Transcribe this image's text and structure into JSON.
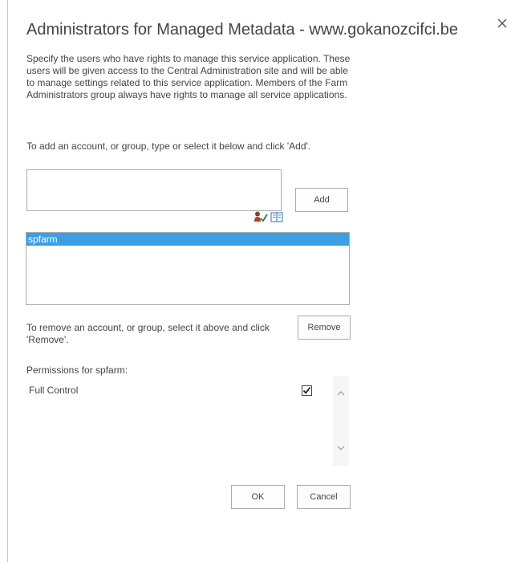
{
  "dialog": {
    "title": "Administrators for Managed Metadata - www.gokanozcifci.be",
    "close_icon": "close-icon"
  },
  "description": "Specify the users who have rights to manage this service application. These users will be given access to the Central Administration site and will be able to manage settings related to this service application. Members of the Farm Administrators group always have rights to manage all service applications.",
  "add_instruction": "To add an account, or group, type or select it below and click 'Add'.",
  "people_picker": {
    "value": "",
    "check_names_icon": "check-names-icon",
    "browse_icon": "address-book-icon"
  },
  "buttons": {
    "add": "Add",
    "remove": "Remove",
    "ok": "OK",
    "cancel": "Cancel"
  },
  "accounts": [
    {
      "name": "spfarm",
      "selected": true
    }
  ],
  "remove_instruction": "To remove an account, or group, select it above and click 'Remove'.",
  "permissions": {
    "label": "Permissions for spfarm:",
    "items": [
      {
        "name": "Full Control",
        "checked": true
      }
    ]
  },
  "colors": {
    "selection": "#3c9fe3",
    "text": "#444444",
    "border": "#ababab"
  }
}
